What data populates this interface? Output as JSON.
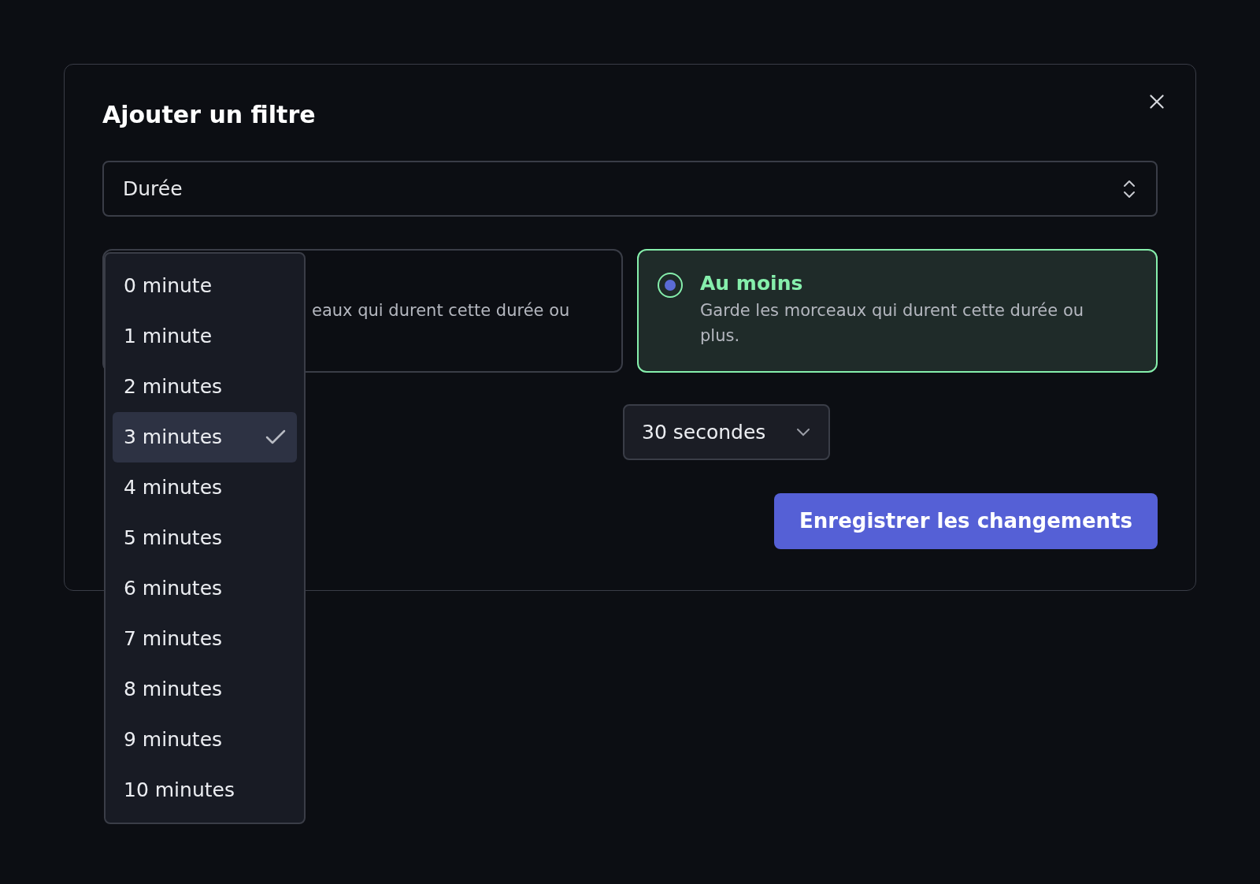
{
  "dialog": {
    "title": "Ajouter un filtre",
    "field": {
      "value": "Durée"
    },
    "options": [
      {
        "description": "eaux qui durent cette durée ou",
        "selected": false
      },
      {
        "title": "Au moins",
        "description": "Garde les morceaux qui durent cette durée ou plus.",
        "selected": true
      }
    ],
    "seconds_select": {
      "value": "30 secondes"
    },
    "save_button": "Enregistrer les changements"
  },
  "minutes_menu": [
    {
      "label": "0 minute",
      "selected": false
    },
    {
      "label": "1 minute",
      "selected": false
    },
    {
      "label": "2 minutes",
      "selected": false
    },
    {
      "label": "3 minutes",
      "selected": true
    },
    {
      "label": "4 minutes",
      "selected": false
    },
    {
      "label": "5 minutes",
      "selected": false
    },
    {
      "label": "6 minutes",
      "selected": false
    },
    {
      "label": "7 minutes",
      "selected": false
    },
    {
      "label": "8 minutes",
      "selected": false
    },
    {
      "label": "9 minutes",
      "selected": false
    },
    {
      "label": "10 minutes",
      "selected": false
    }
  ]
}
